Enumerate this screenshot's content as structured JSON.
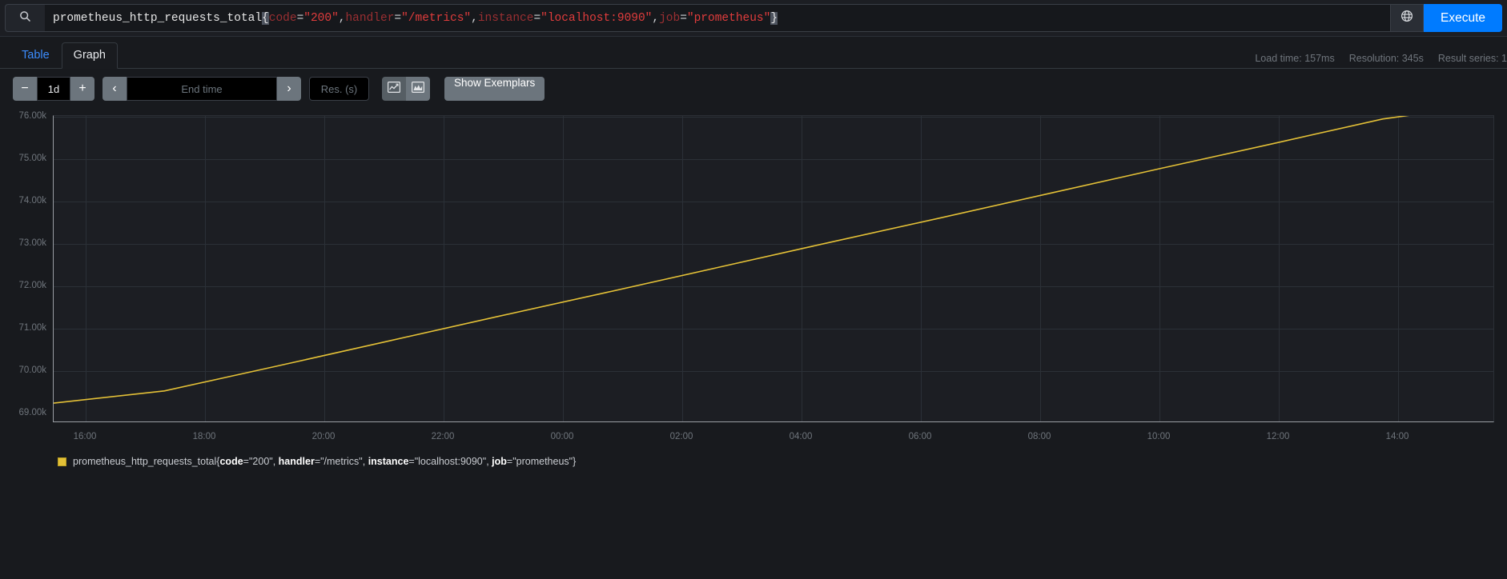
{
  "query": {
    "search_icon": "search-icon",
    "metric": "prometheus_http_requests_total",
    "open_brace": "{",
    "close_brace": "}",
    "matchers": [
      {
        "label": "code",
        "op": "=",
        "value": "\"200\"",
        "sep": ", "
      },
      {
        "label": "handler",
        "op": "=",
        "value": "\"/metrics\"",
        "sep": ", "
      },
      {
        "label": "instance",
        "op": "=",
        "value": "\"localhost:9090\"",
        "sep": ", "
      },
      {
        "label": "job",
        "op": "=",
        "value": "\"prometheus\"",
        "sep": ""
      }
    ],
    "globe_icon": "globe-icon",
    "execute_label": "Execute",
    "accent_color": "#007bff"
  },
  "tabs": [
    {
      "label": "Table",
      "active": false
    },
    {
      "label": "Graph",
      "active": true
    }
  ],
  "meta": {
    "load_time": "Load time: 157ms",
    "resolution": "Resolution: 345s",
    "result_series": "Result series: 1"
  },
  "toolbar": {
    "decrease_label": "−",
    "range_value": "1d",
    "increase_label": "+",
    "prev_label": "‹",
    "end_time_placeholder": "End time",
    "end_time_value": "",
    "next_label": "›",
    "resolution_placeholder": "Res. (s)",
    "resolution_value": "",
    "line_chart_icon": "line-chart-icon",
    "stacked_chart_icon": "stacked-chart-icon",
    "exemplars_label": "Show Exemplars"
  },
  "chart_data": {
    "type": "line",
    "title": "",
    "xlabel": "",
    "ylabel": "",
    "ylim": [
      69000,
      76000
    ],
    "ytick_labels": [
      "76.00k",
      "75.00k",
      "74.00k",
      "73.00k",
      "72.00k",
      "71.00k",
      "70.00k",
      "69.00k"
    ],
    "ytick_values": [
      76000,
      75000,
      74000,
      73000,
      72000,
      71000,
      70000,
      69000
    ],
    "xtick_labels": [
      "16:00",
      "18:00",
      "20:00",
      "22:00",
      "00:00",
      "02:00",
      "04:00",
      "06:00",
      "08:00",
      "10:00",
      "12:00",
      "14:00"
    ],
    "grid": true,
    "legend_position": "bottom",
    "series": [
      {
        "name": "prometheus_http_requests_total{code=\"200\", handler=\"/metrics\", instance=\"localhost:9090\", job=\"prometheus\"}",
        "color": "#e3c037",
        "x": [
          "15:12",
          "16:00",
          "18:00",
          "20:00",
          "22:00",
          "00:00",
          "02:00",
          "04:00",
          "06:00",
          "08:00",
          "10:00",
          "12:00",
          "14:00",
          "15:12"
        ],
        "values": [
          69420,
          69700,
          70260,
          70830,
          71400,
          71960,
          72530,
          73100,
          73660,
          74230,
          74800,
          75360,
          75930,
          76280
        ]
      }
    ]
  },
  "legend": {
    "swatch_color": "#e3c037",
    "metric": "prometheus_http_requests_total",
    "open_brace": "{",
    "close_brace": "}",
    "labels": [
      {
        "key": "code",
        "value": "=\"200\", "
      },
      {
        "key": "handler",
        "value": "=\"/metrics\", "
      },
      {
        "key": "instance",
        "value": "=\"localhost:9090\", "
      },
      {
        "key": "job",
        "value": "=\"prometheus\""
      }
    ]
  }
}
